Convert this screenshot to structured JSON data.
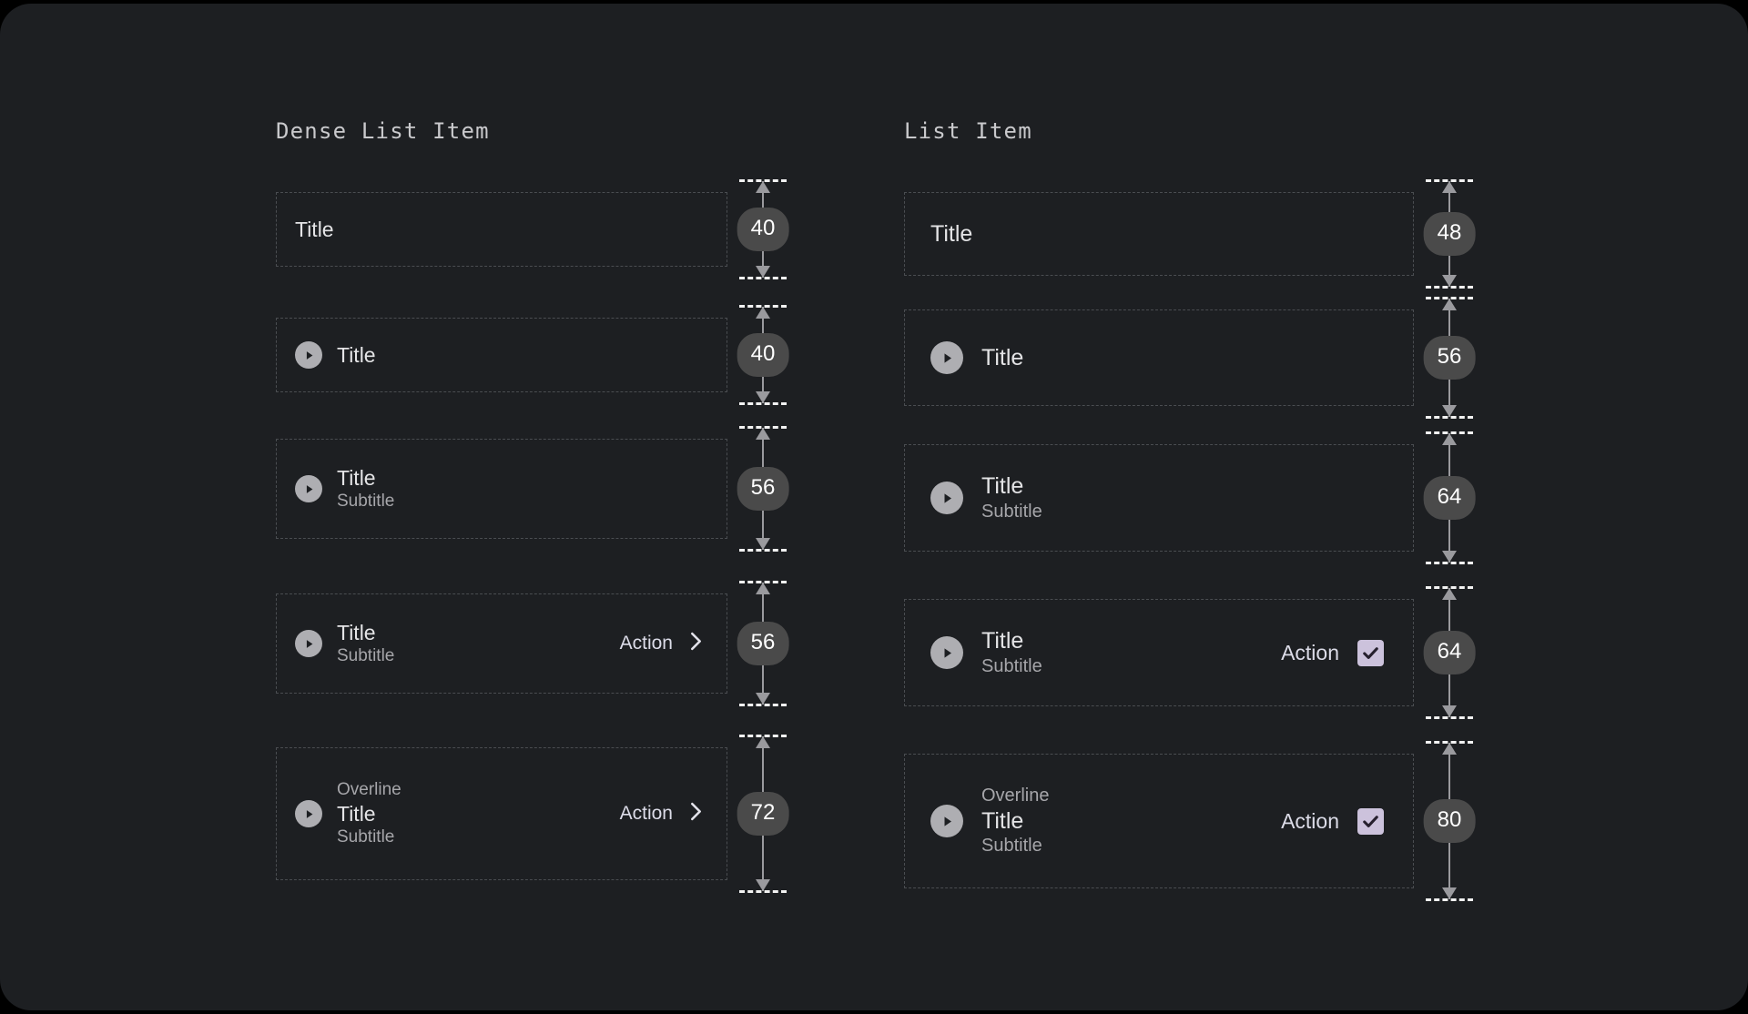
{
  "page": {
    "background": "#000000",
    "card_background": "#1D1F22",
    "accent_checkbox": "#CCC2DC",
    "avatar_color": "#AEAEB2",
    "badge_color": "#4A4A4A",
    "dashed_border_color": "#4A4D51",
    "measure_line_color": "#F2F2F2"
  },
  "columns": [
    {
      "id": "dense-list-item",
      "header": "Dense List Item",
      "rows": [
        {
          "name": "title-only",
          "height": "40",
          "badge": "40",
          "has_avatar": false,
          "overline": null,
          "title": "Title",
          "subtitle": null,
          "action": null,
          "trailing_icon": null
        },
        {
          "name": "avatar-title",
          "height": "40",
          "badge": "40",
          "has_avatar": true,
          "overline": null,
          "title": "Title",
          "subtitle": null,
          "action": null,
          "trailing_icon": null
        },
        {
          "name": "avatar-title-subtitle",
          "height": "56",
          "badge": "56",
          "has_avatar": true,
          "overline": null,
          "title": "Title",
          "subtitle": "Subtitle",
          "action": null,
          "trailing_icon": null
        },
        {
          "name": "avatar-title-subtitle-action",
          "height": "56",
          "badge": "56",
          "has_avatar": true,
          "overline": null,
          "title": "Title",
          "subtitle": "Subtitle",
          "action": "Action",
          "trailing_icon": "chevron-right-icon"
        },
        {
          "name": "avatar-overline-title-subtitle-action",
          "height": "72",
          "badge": "72",
          "has_avatar": true,
          "overline": "Overline",
          "title": "Title",
          "subtitle": "Subtitle",
          "action": "Action",
          "trailing_icon": "chevron-right-icon"
        }
      ]
    },
    {
      "id": "list-item",
      "header": "List Item",
      "rows": [
        {
          "name": "title-only",
          "height": "48",
          "badge": "48",
          "has_avatar": false,
          "overline": null,
          "title": "Title",
          "subtitle": null,
          "action": null,
          "trailing_icon": null
        },
        {
          "name": "avatar-title",
          "height": "56",
          "badge": "56",
          "has_avatar": true,
          "overline": null,
          "title": "Title",
          "subtitle": null,
          "action": null,
          "trailing_icon": null
        },
        {
          "name": "avatar-title-subtitle",
          "height": "64",
          "badge": "64",
          "has_avatar": true,
          "overline": null,
          "title": "Title",
          "subtitle": "Subtitle",
          "action": null,
          "trailing_icon": null
        },
        {
          "name": "avatar-title-subtitle-action",
          "height": "64",
          "badge": "64",
          "has_avatar": true,
          "overline": null,
          "title": "Title",
          "subtitle": "Subtitle",
          "action": "Action",
          "trailing_icon": "checkbox-checked-icon"
        },
        {
          "name": "avatar-overline-title-subtitle-action",
          "height": "80",
          "badge": "80",
          "has_avatar": true,
          "overline": "Overline",
          "title": "Title",
          "subtitle": "Subtitle",
          "action": "Action",
          "trailing_icon": "checkbox-checked-icon"
        }
      ]
    }
  ]
}
